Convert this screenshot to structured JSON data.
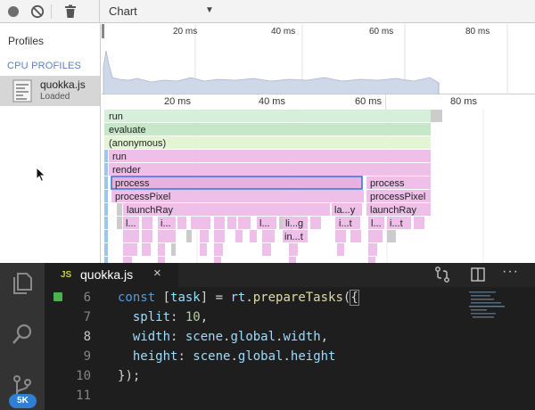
{
  "devtools": {
    "toolbar": {
      "view_select": "Chart"
    },
    "sidebar": {
      "header": "Profiles",
      "section_label": "CPU PROFILES",
      "profile": {
        "name": "quokka.js",
        "status": "Loaded"
      }
    },
    "overview_ruler": [
      "20 ms",
      "40 ms",
      "60 ms",
      "80 ms"
    ],
    "flame_ruler": [
      "20 ms",
      "40 ms",
      "60 ms",
      "80 ms"
    ],
    "flame_rows": [
      "run",
      "evaluate",
      "(anonymous)",
      "run",
      "render",
      "process",
      "process",
      "processPixel",
      "processPixel",
      "launchRay",
      "la...y",
      "launchRay",
      "l...",
      "i...",
      "l...",
      "li...g",
      "i...t",
      "l...",
      "i...t",
      "in...t"
    ],
    "colors": {
      "green_light": "#d6efd9",
      "green": "#c7e9c9",
      "lime": "#e3f4d3",
      "pink": "#eebfe8",
      "pink_dark": "#e8b2e0",
      "selection": "#2f6fd6"
    }
  },
  "editor": {
    "tab": {
      "lang": "JS",
      "title": "quokka.js",
      "close": "×"
    },
    "badge": "5K",
    "more": "···",
    "lines": [
      {
        "n": "6",
        "tokens": [
          [
            "kw",
            "const "
          ],
          [
            "pl",
            "["
          ],
          [
            "vr",
            "task"
          ],
          [
            "pl",
            "] = "
          ],
          [
            "vr",
            "rt"
          ],
          [
            "pl",
            "."
          ],
          [
            "fn",
            "prepareTasks"
          ],
          [
            "pl",
            "("
          ],
          [
            "pl",
            "{"
          ]
        ]
      },
      {
        "n": "7",
        "tokens": [
          [
            "vr",
            "  split"
          ],
          [
            "pl",
            ": "
          ],
          [
            "nm",
            "10"
          ],
          [
            "pl",
            ","
          ]
        ]
      },
      {
        "n": "8",
        "tokens": [
          [
            "vr",
            "  width"
          ],
          [
            "pl",
            ": "
          ],
          [
            "vr",
            "scene"
          ],
          [
            "pl",
            "."
          ],
          [
            "vr",
            "global"
          ],
          [
            "pl",
            "."
          ],
          [
            "vr",
            "width"
          ],
          [
            "pl",
            ","
          ]
        ]
      },
      {
        "n": "9",
        "tokens": [
          [
            "vr",
            "  height"
          ],
          [
            "pl",
            ": "
          ],
          [
            "vr",
            "scene"
          ],
          [
            "pl",
            "."
          ],
          [
            "vr",
            "global"
          ],
          [
            "pl",
            "."
          ],
          [
            "vr",
            "height"
          ]
        ]
      },
      {
        "n": "10",
        "tokens": [
          [
            "pl",
            "}"
          ],
          [
            "pl",
            ");"
          ]
        ]
      },
      {
        "n": "11",
        "tokens": []
      }
    ]
  }
}
